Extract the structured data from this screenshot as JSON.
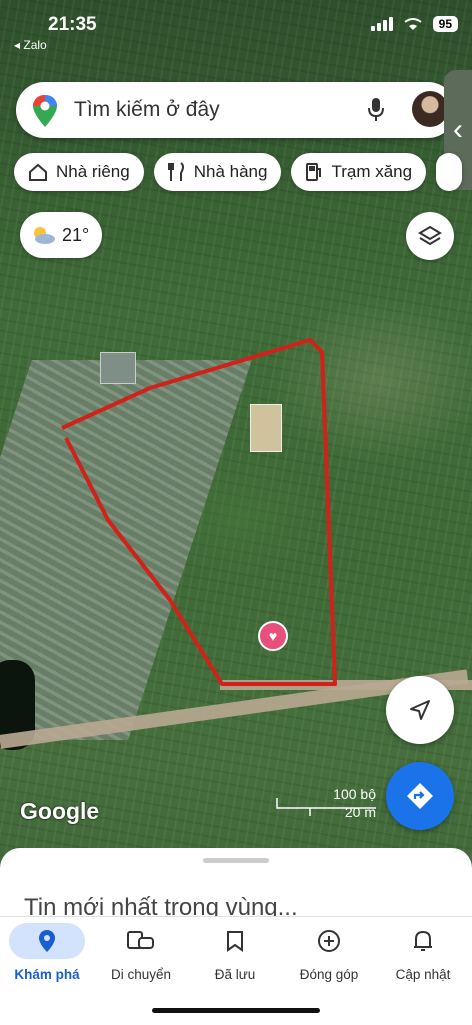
{
  "status_bar": {
    "time": "21:35",
    "back_app": "◂ Zalo",
    "battery": "95"
  },
  "search": {
    "placeholder": "Tìm kiếm ở đây",
    "mic_icon": "mic-icon"
  },
  "chips": [
    {
      "label": "Nhà riêng",
      "icon": "home-icon"
    },
    {
      "label": "Nhà hàng",
      "icon": "restaurant-icon"
    },
    {
      "label": "Trạm xăng",
      "icon": "gas-station-icon"
    }
  ],
  "weather": {
    "temp": "21°"
  },
  "map": {
    "brand": "Google",
    "scale_top": "100 bộ",
    "scale_bottom": "20 m",
    "boundary_color": "#d0221a"
  },
  "sheet": {
    "headline": "Tin mới nhất trong vùng..."
  },
  "bottom_nav": [
    {
      "label": "Khám phá",
      "active": true
    },
    {
      "label": "Di chuyển"
    },
    {
      "label": "Đã lưu"
    },
    {
      "label": "Đóng góp"
    },
    {
      "label": "Cập nhật"
    }
  ],
  "colors": {
    "accent": "#1a73e8",
    "active_nav": "#d3e3fd"
  }
}
